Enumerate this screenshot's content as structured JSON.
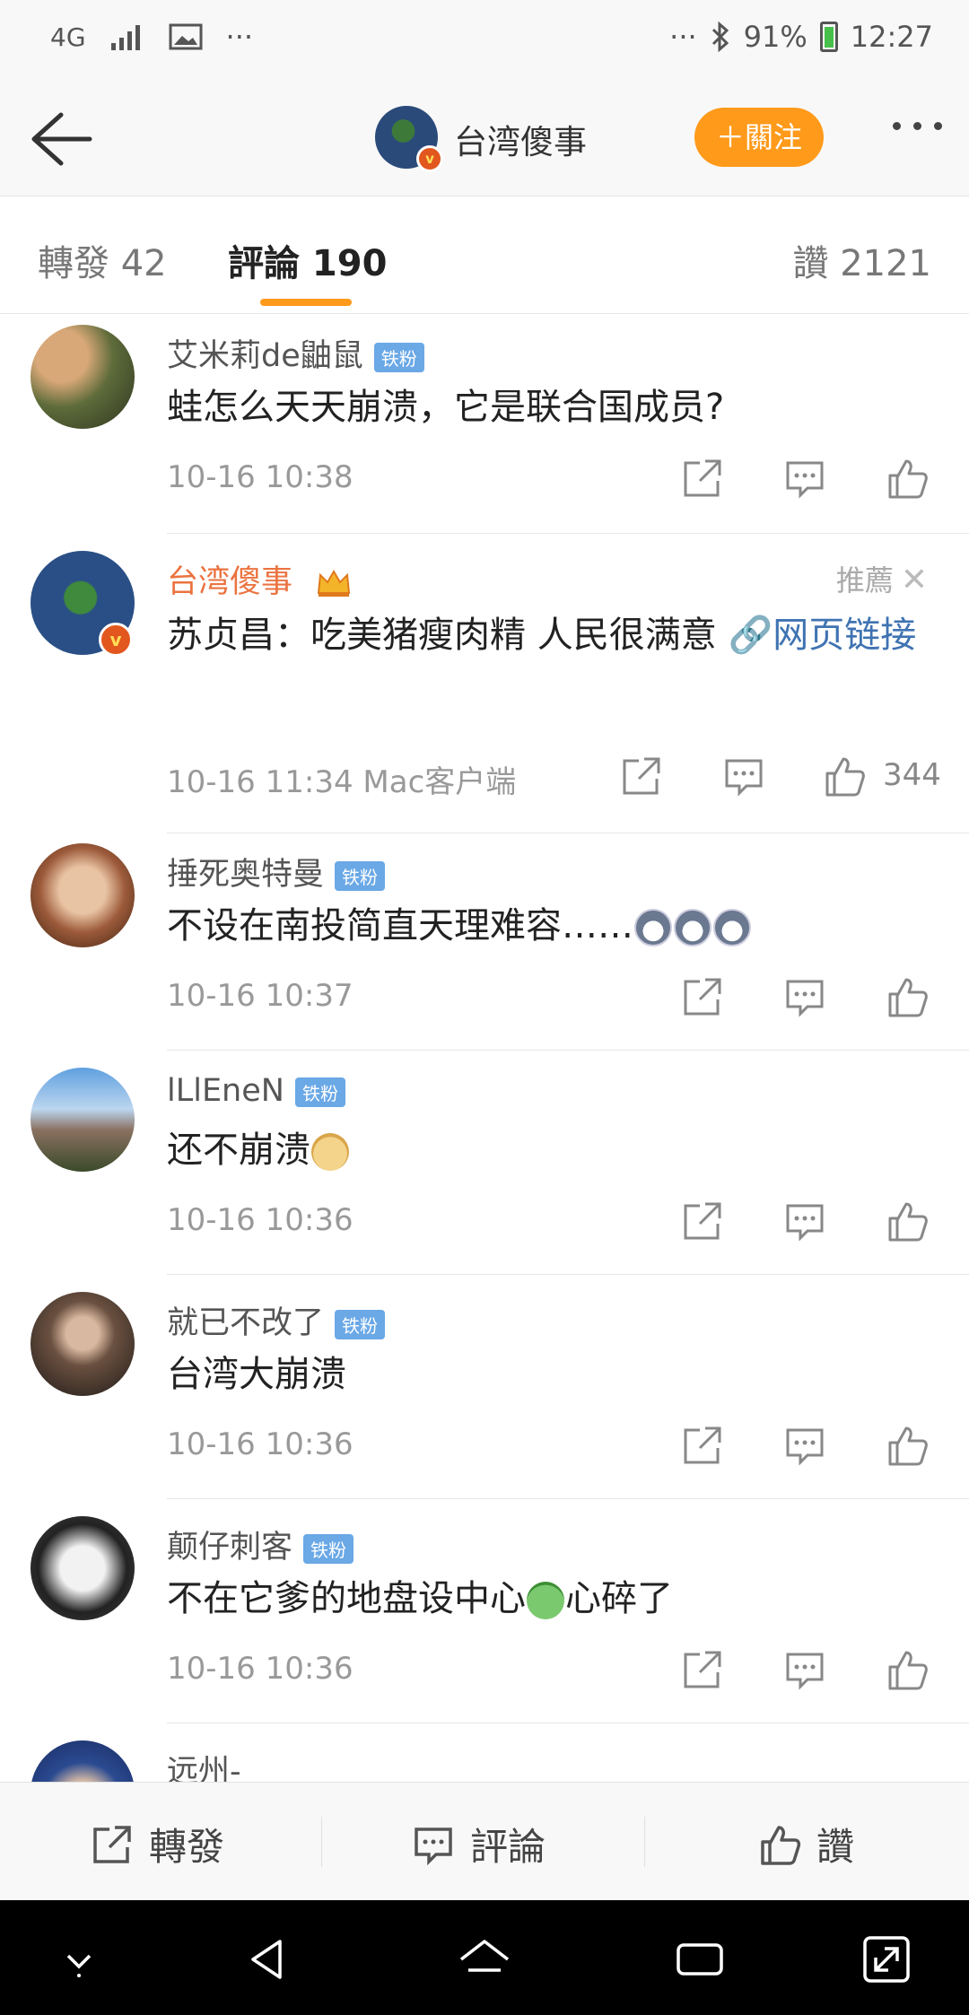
{
  "status_bar": {
    "network": "4G",
    "dots": "···",
    "battery": "91%",
    "time": "12:27"
  },
  "header": {
    "title": "台湾傻事",
    "follow_label": "＋關注"
  },
  "tabs": {
    "repost": "轉發 42",
    "comments": "評論 190",
    "likes": "讚 2121"
  },
  "comments": [
    {
      "user": "艾米莉de鼬鼠",
      "badge": "铁粉",
      "text": "蛙怎么天天崩溃，它是联合国成员?",
      "time": "10-16 10:38"
    },
    {
      "user": "台湾傻事",
      "text": "苏贞昌：吃美猪瘦肉精 人民很满意 ",
      "link": "🔗网页链接",
      "time": "10-16 11:34  Mac客户端",
      "likes": "344",
      "recommend": "推薦",
      "close": "✕"
    },
    {
      "user": "捶死奥特曼",
      "badge": "铁粉",
      "text": "不设在南投简直天理难容……",
      "time": "10-16 10:37"
    },
    {
      "user": "lLlEneN",
      "badge": "铁粉",
      "text": "还不崩溃",
      "time": "10-16 10:36"
    },
    {
      "user": "就已不改了",
      "badge": "铁粉",
      "text": "台湾大崩溃",
      "time": "10-16 10:36"
    },
    {
      "user": "颠仔刺客",
      "badge": "铁粉",
      "text_a": "不在它爹的地盘设中心",
      "text_b": "心碎了",
      "time": "10-16 10:36"
    },
    {
      "user": "远州-"
    }
  ],
  "bottom_bar": {
    "repost": "轉發",
    "comment": "評論",
    "like": "讚"
  },
  "colors": {
    "accent": "#ff9a1a",
    "vip_name": "#eb7340",
    "link": "#3f73b2",
    "fan_badge": "#6aa8e6"
  }
}
